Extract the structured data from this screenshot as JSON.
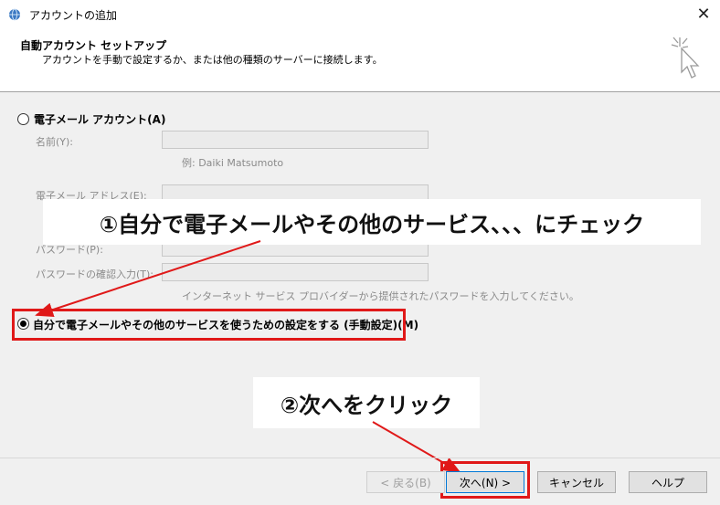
{
  "window": {
    "title": "アカウントの追加",
    "close_glyph": "✕"
  },
  "header": {
    "title": "自動アカウント セットアップ",
    "subtitle": "アカウントを手動で設定するか、または他の種類のサーバーに接続します。"
  },
  "email_option": {
    "label": "電子メール アカウント(A)",
    "selected": false
  },
  "fields": {
    "name_label": "名前(Y):",
    "name_value": "",
    "name_example": "例: Daiki Matsumoto",
    "email_label": "電子メール アドレス(E):",
    "email_value": "",
    "password_label": "パスワード(P):",
    "password_value": "",
    "password_confirm_label": "パスワードの確認入力(T):",
    "password_confirm_value": "",
    "password_hint": "インターネット サービス プロバイダーから提供されたパスワードを入力してください。"
  },
  "manual_option": {
    "label": "自分で電子メールやその他のサービスを使うための設定をする (手動設定)(M)",
    "selected": true
  },
  "annotations": {
    "step1": "①自分で電子メールやその他のサービス、、、にチェック",
    "step2": "②次へをクリック"
  },
  "buttons": {
    "back": "< 戻る(B)",
    "next": "次へ(N) >",
    "cancel": "キャンセル",
    "help": "ヘルプ"
  },
  "colors": {
    "highlight_red": "#e01919",
    "accent_blue": "#0078d7"
  }
}
